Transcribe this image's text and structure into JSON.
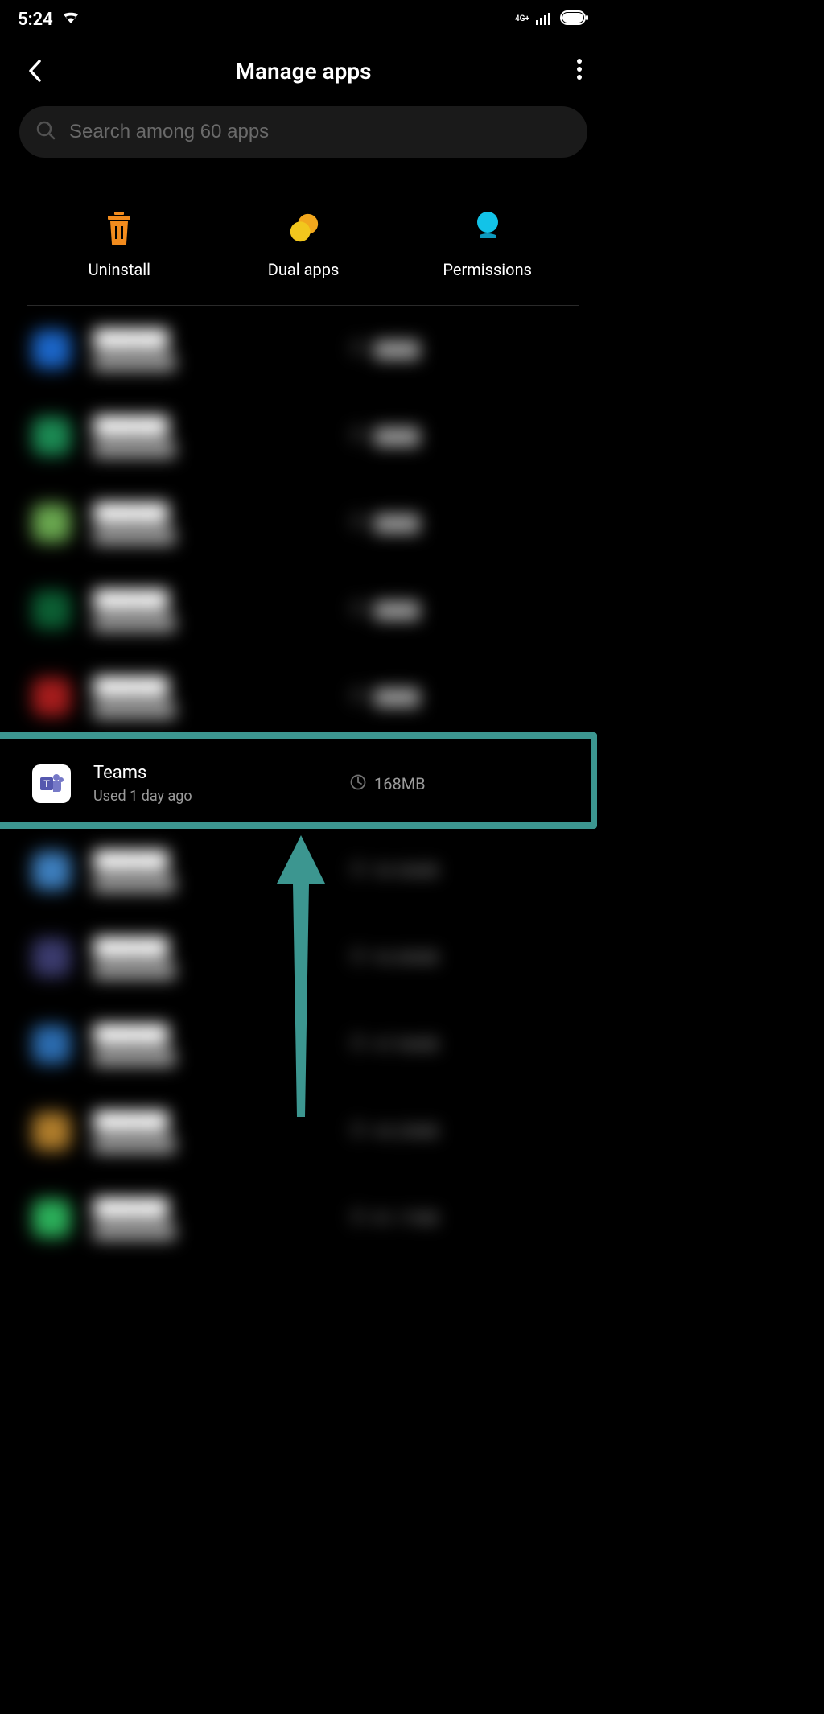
{
  "status": {
    "time": "5:24",
    "network_label": "4G+"
  },
  "header": {
    "title": "Manage apps"
  },
  "search": {
    "placeholder": "Search among 60 apps"
  },
  "actions": {
    "uninstall": "Uninstall",
    "dual": "Dual apps",
    "permissions": "Permissions"
  },
  "apps": [
    {
      "name": "",
      "sub": "",
      "size": "",
      "blurred": true,
      "icon_color": "#1b66c9"
    },
    {
      "name": "",
      "sub": "",
      "size": "",
      "blurred": true,
      "icon_color": "#1b8a53"
    },
    {
      "name": "",
      "sub": "",
      "size": "",
      "blurred": true,
      "icon_color": "#6aa84f"
    },
    {
      "name": "",
      "sub": "",
      "size": "",
      "blurred": true,
      "icon_color": "#0b5f33"
    },
    {
      "name": "",
      "sub": "",
      "size": "",
      "blurred": true,
      "icon_color": "#a61c1c"
    },
    {
      "name": "Teams",
      "sub": "Used 1 day ago",
      "size": "168MB",
      "blurred": false,
      "highlight": true,
      "icon": "teams"
    },
    {
      "name": "",
      "sub": "",
      "size": "53.56MB",
      "blurred": true,
      "icon_color": "#3d7fbf"
    },
    {
      "name": "",
      "sub": "",
      "size": "92.80MB",
      "blurred": true,
      "icon_color": "#3b3b6e"
    },
    {
      "name": "",
      "sub": "",
      "size": "47.96MB",
      "blurred": true,
      "icon_color": "#2b6cb0"
    },
    {
      "name": "",
      "sub": "",
      "size": "43.20MB",
      "blurred": true,
      "icon_color": "#b07d2b"
    },
    {
      "name": "",
      "sub": "",
      "size": "81.17MB",
      "blurred": true,
      "icon_color": "#2bb05a"
    }
  ],
  "annotation": {
    "arrow_color": "#3c9690"
  }
}
